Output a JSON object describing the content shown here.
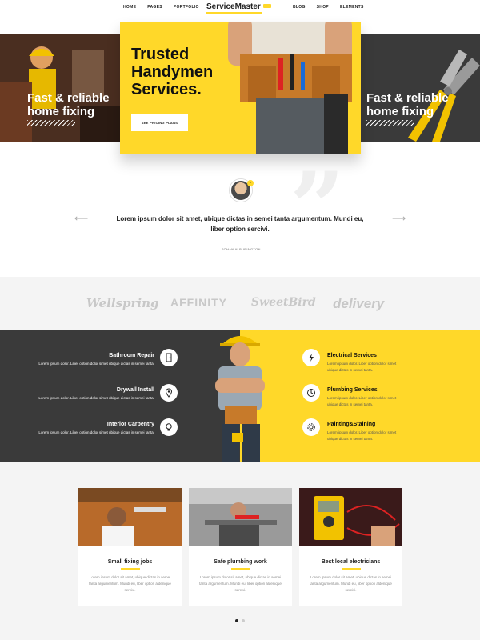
{
  "nav": {
    "left": [
      "HOME",
      "PAGES",
      "PORTFOLIO"
    ],
    "right": [
      "BLOG",
      "SHOP",
      "ELEMENTS"
    ],
    "logo": "ServiceMaster"
  },
  "hero": {
    "left_title": "Fast & reliable home fixing",
    "center_title": "Trusted Handymen Services.",
    "button": "SEE PRICING PLANS",
    "right_title": "Fast & reliable home fixing"
  },
  "testimonial": {
    "text": "Lorem ipsum dolor sit amet, ubique dictas in semei tanta argumentum. Mundi eu, liber option sercivi.",
    "author": "- JOHAN ALBURINGTON"
  },
  "logos": [
    "Wellspring",
    "AFFINITY",
    "SweetBird",
    "delivery"
  ],
  "services_left": [
    {
      "title": "Bathroom Repair",
      "desc": "Lorem ipsum dolor. Liber option dolor simet ubique dictas in semei tanta.",
      "icon": "door-icon"
    },
    {
      "title": "Drywall Install",
      "desc": "Lorem ipsum dolor. Liber option dolor simet ubique dictas in semei tanta.",
      "icon": "location-pin-icon"
    },
    {
      "title": "Interior Carpentry",
      "desc": "Lorem ipsum dolor. Liber option dolor simet ubique dictas in semei tanta.",
      "icon": "lightbulb-icon"
    }
  ],
  "services_right": [
    {
      "title": "Electrical Services",
      "desc": "Lorem ipsum dolor. Liber option dolor simet ubique dictas in semei tanta.",
      "icon": "lightning-icon"
    },
    {
      "title": "Plumbing Services",
      "desc": "Lorem ipsum dolor. Liber option dolor simet ubique dictas in semei tanta.",
      "icon": "clock-icon"
    },
    {
      "title": "Painting&Staining",
      "desc": "Lorem ipsum dolor. Liber option dolor simet ubique dictas in semei tanta.",
      "icon": "gear-icon"
    }
  ],
  "cards": [
    {
      "title": "Small fixing jobs",
      "text": "Lorem ipsum dolor sit amet, ubique dictas in semei tanta argumentum. Mundi eu, liber option aldenique sercivi."
    },
    {
      "title": "Safe plumbing work",
      "text": "Lorem ipsum dolor sit amet, ubique dictas in semei tanta argumentum. Mundi eu, liber option aldenique sercivi."
    },
    {
      "title": "Best local electricians",
      "text": "Lorem ipsum dolor sit amet, ubique dictas in semei tanta argumentum. Mundi eu, liber option aldenique sercivi."
    }
  ],
  "colors": {
    "accent": "#ffd829",
    "dark": "#3a3a3a",
    "light_bg": "#f4f4f4"
  }
}
